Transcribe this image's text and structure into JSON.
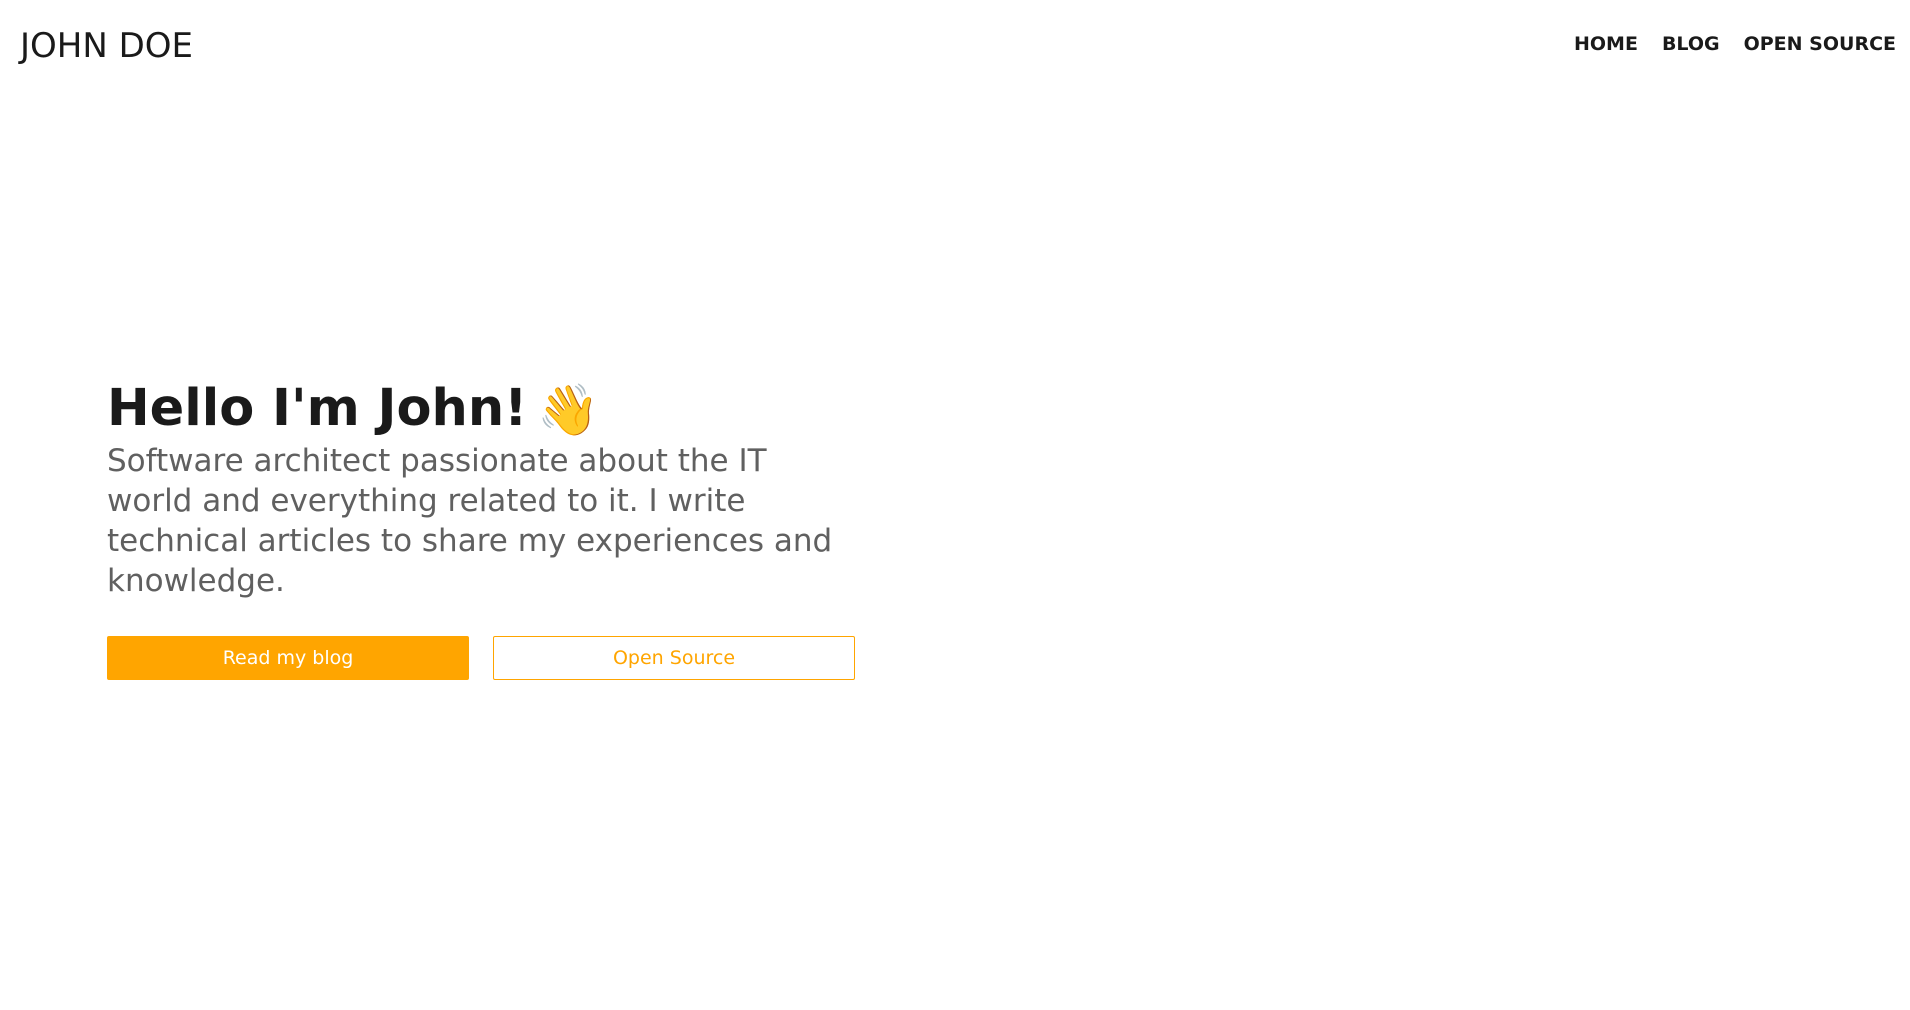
{
  "header": {
    "site_title": "JOHN DOE",
    "nav": [
      "HOME",
      "BLOG",
      "OPEN SOURCE"
    ]
  },
  "hero": {
    "heading": "Hello I'm John!",
    "wave_emoji": "👋",
    "description": "Software architect passionate about the IT world and everything related to it. I write technical articles to share my experiences and knowledge.",
    "buttons": {
      "primary": "Read my blog",
      "secondary": "Open Source"
    }
  },
  "colors": {
    "accent": "#ffa500",
    "heading": "#1a1a1a",
    "body_text": "#606060",
    "background": "#ffffff"
  }
}
